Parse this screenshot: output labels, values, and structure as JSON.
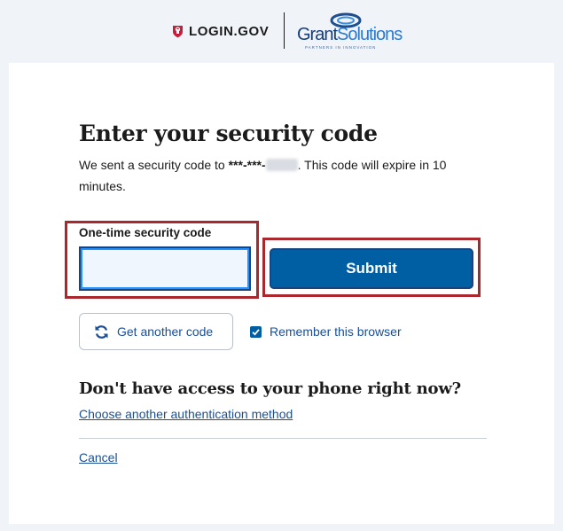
{
  "header": {
    "login_brand": "LOGIN.GOV",
    "partner_brand_part1": "Grant",
    "partner_brand_part2": "Solutions",
    "partner_tagline": "PARTNERS IN INNOVATION"
  },
  "main": {
    "title": "Enter your security code",
    "description_prefix": "We sent a security code to ",
    "masked_phone": "***-***-",
    "description_suffix": ". This code will expire in 10 minutes.",
    "code_label": "One-time security code",
    "code_value": "",
    "submit_label": "Submit",
    "get_another_label": "Get another code",
    "remember_label": "Remember this browser",
    "remember_checked": true,
    "subtitle": "Don't have access to your phone right now?",
    "choose_method_link": "Choose another authentication method",
    "cancel_link": "Cancel"
  },
  "colors": {
    "primary": "#005ea2",
    "link": "#1a4f95",
    "highlight_border": "#a9272d",
    "login_red": "#c41e3a",
    "background": "#f0f3f8"
  },
  "icons": {
    "login": "shield-icon",
    "get_another": "refresh-icon",
    "checkbox": "checkmark-icon"
  }
}
